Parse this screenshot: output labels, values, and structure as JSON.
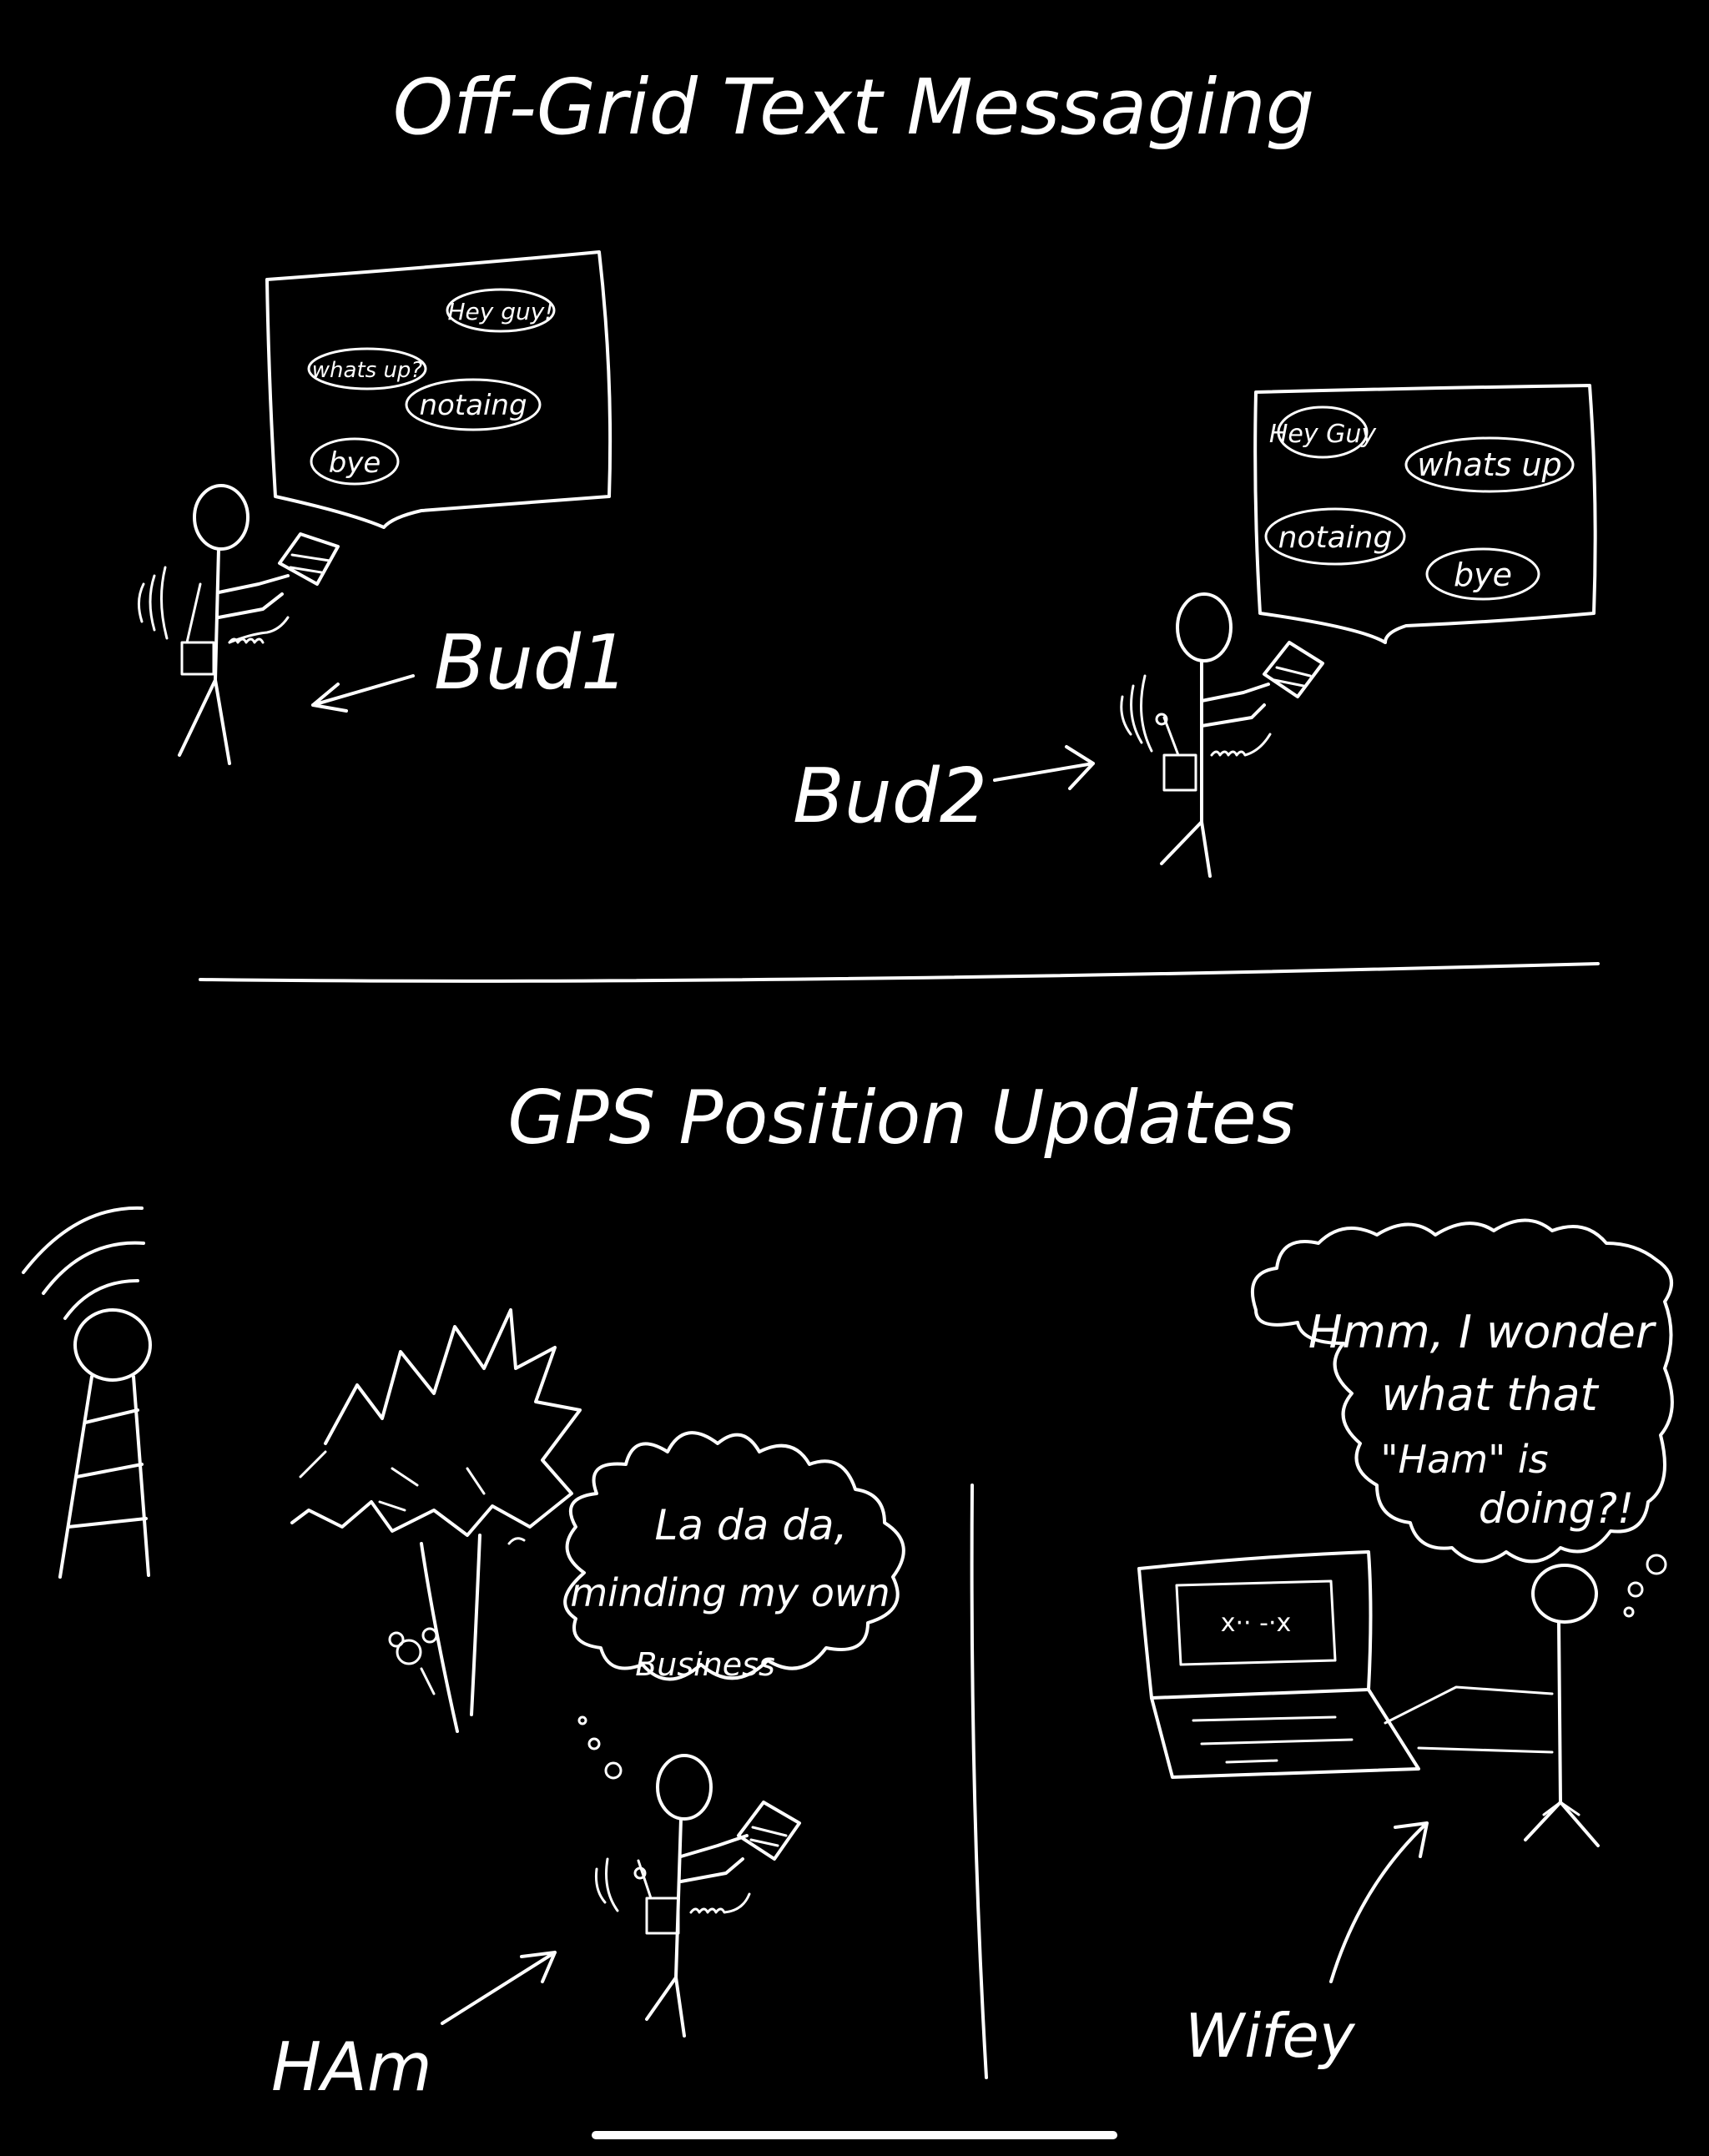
{
  "titles": {
    "top": "Off-Grid Text Messaging",
    "bottom": "GPS Position Updates"
  },
  "bud1": {
    "label": "Bud1",
    "messages": [
      "Hey guy!",
      "whats up?",
      "notaing",
      "bye"
    ]
  },
  "bud2": {
    "label": "Bud2",
    "messages": [
      "Hey Guy",
      "whats up",
      "notaing",
      "bye"
    ]
  },
  "ham": {
    "label": "HAm",
    "thought": [
      "La da da,",
      "minding my own",
      "Business"
    ]
  },
  "wife": {
    "label": "Wifey",
    "thought": [
      "Hmm, I wonder",
      "what that",
      "\"Ham\" is",
      "doing?!"
    ],
    "laptop_screen": "x·· -·x"
  },
  "colors": {
    "background": "#000000",
    "ink": "#ffffff"
  }
}
